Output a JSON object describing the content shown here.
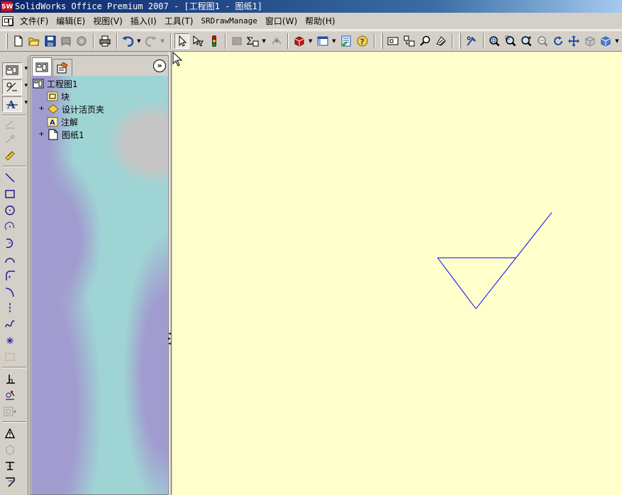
{
  "window": {
    "title": "SolidWorks Office Premium 2007 - [工程图1 - 图纸1]",
    "app_logo": "SW"
  },
  "menubar": {
    "items": [
      "文件(F)",
      "编辑(E)",
      "视图(V)",
      "插入(I)",
      "工具(T)",
      "SRDrawManage",
      "窗口(W)",
      "帮助(H)"
    ]
  },
  "toolbar": {
    "icons": [
      "new-document-icon",
      "open-folder-icon",
      "save-icon",
      "print-preview-icon",
      "options-icon",
      "print-icon",
      "undo-icon",
      "redo-icon",
      "select-pointer-icon",
      "select-filter-icon",
      "rebuild-icon",
      "layer-icon",
      "dimension-icon",
      "auto-balloon-icon",
      "3d-box-icon",
      "window-icon",
      "properties-icon",
      "help-icon",
      "drawing-view-icon",
      "move-view-icon",
      "find-icon",
      "hatch-icon",
      "sketch-tool-icon",
      "zoom-fit-icon",
      "zoom-area-icon",
      "zoom-in-out-icon",
      "zoom-out-icon",
      "rotate-icon",
      "pan-icon",
      "view-orientation-icon",
      "display-style-icon"
    ]
  },
  "feature_manager": {
    "tabs": [
      "feature-tree-tab",
      "property-manager-tab"
    ],
    "expand_label": "»",
    "tree": [
      {
        "label": "工程图1",
        "icon": "drawing-icon",
        "expandable": false,
        "indent": 0
      },
      {
        "label": "块",
        "icon": "block-icon",
        "expandable": false,
        "indent": 1
      },
      {
        "label": "设计活页夹",
        "icon": "design-binder-icon",
        "expandable": true,
        "indent": 1
      },
      {
        "label": "注解",
        "icon": "annotation-icon",
        "expandable": false,
        "indent": 1
      },
      {
        "label": "图纸1",
        "icon": "sheet-icon",
        "expandable": true,
        "indent": 1
      }
    ]
  },
  "canvas": {
    "background": "#ffffcc",
    "sketch_color": "#0000ff",
    "entity": "surface-finish-symbol"
  },
  "colors": {
    "title_gradient_start": "#0a246a",
    "title_gradient_end": "#a6caf0",
    "chrome": "#d4d0c8",
    "canvas_bg": "#ffffcc",
    "tree_bg_teal": "#9fd4d4",
    "tree_bg_purple": "#a19ccf"
  }
}
